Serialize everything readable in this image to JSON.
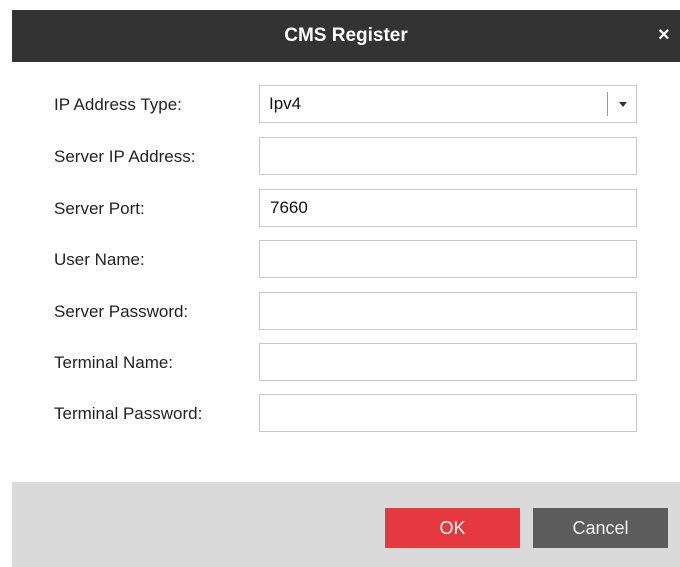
{
  "dialog": {
    "title": "CMS Register",
    "close_glyph": "×"
  },
  "form": {
    "ip_address_type": {
      "label": "IP Address Type:",
      "value": "Ipv4"
    },
    "server_ip_address": {
      "label": "Server IP Address:",
      "value": ""
    },
    "server_port": {
      "label": "Server Port:",
      "value": "7660"
    },
    "user_name": {
      "label": "User Name:",
      "value": ""
    },
    "server_password": {
      "label": "Server Password:",
      "value": ""
    },
    "terminal_name": {
      "label": "Terminal Name:",
      "value": ""
    },
    "terminal_password": {
      "label": "Terminal Password:",
      "value": ""
    }
  },
  "buttons": {
    "ok_label": "OK",
    "cancel_label": "Cancel"
  },
  "colors": {
    "titlebar": "#333333",
    "ok": "#e5383f",
    "cancel": "#5c5c5c",
    "footer": "#dadada"
  },
  "icons": {
    "close": "close-icon",
    "dropdown": "chevron-down-icon"
  }
}
